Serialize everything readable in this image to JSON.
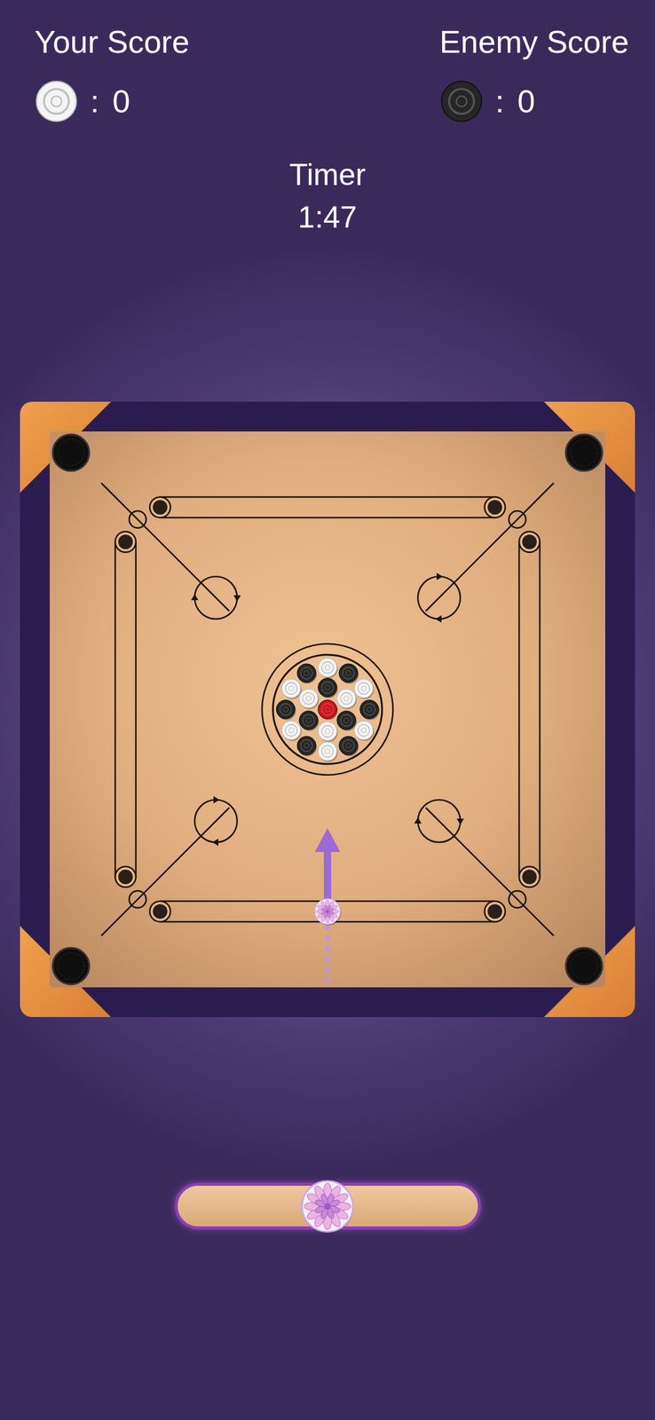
{
  "player": {
    "label": "Your Score",
    "separator": ":",
    "score": "0",
    "color": "#f4f4f4"
  },
  "enemy": {
    "label": "Enemy Score",
    "separator": ":",
    "score": "0",
    "color": "#262626"
  },
  "timer": {
    "label": "Timer",
    "value": "1:47"
  },
  "coins": {
    "queen": "#d0141e",
    "inner": [
      "#262626",
      "#f4f4f4",
      "#262626",
      "#f4f4f4",
      "#262626",
      "#f4f4f4"
    ],
    "outer": [
      "#f4f4f4",
      "#262626",
      "#f4f4f4",
      "#262626",
      "#f4f4f4",
      "#262626",
      "#f4f4f4",
      "#262626",
      "#f4f4f4",
      "#262626",
      "#f4f4f4",
      "#262626"
    ]
  },
  "striker": {
    "level": 0.5
  }
}
